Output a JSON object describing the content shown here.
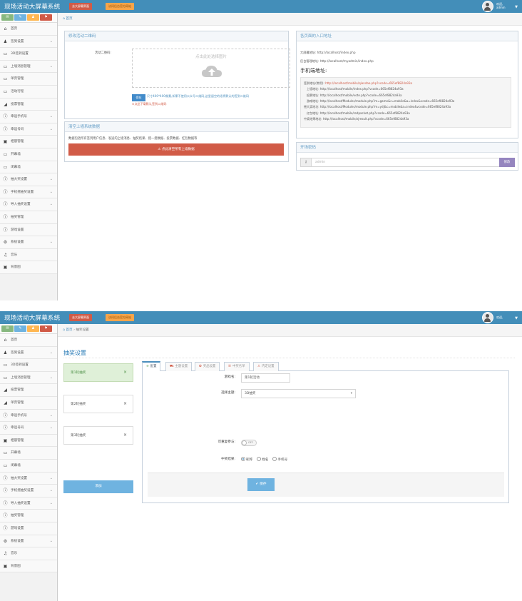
{
  "app": {
    "brand": "现场活动大屏幕系统",
    "btn_big_screen": "去大屏幕界面",
    "btn_official": "访问后台官方网站",
    "user_greeting": "欢迎,",
    "user_name": "admin"
  },
  "shortcut_icons": [
    "chat-icon",
    "pencil-icon",
    "group-icon",
    "share-icon"
  ],
  "colors": {
    "topbar": "#438eb9",
    "danger": "#d15b47",
    "warning": "#f7a54a",
    "primary": "#428bca",
    "info": "#6fb3e0",
    "purple": "#9585bf"
  },
  "nav1": [
    {
      "label": "首页",
      "icon": "home-icon",
      "arrow": false
    },
    {
      "label": "签到设置",
      "icon": "users-icon",
      "arrow": true
    },
    {
      "label": "3D签到设置",
      "icon": "desktop-icon",
      "arrow": false
    },
    {
      "label": "上墙消息管理",
      "icon": "desktop-icon",
      "arrow": true
    },
    {
      "label": "单页管理",
      "icon": "desktop-icon",
      "arrow": false
    },
    {
      "label": "活动行程",
      "icon": "desktop-icon",
      "arrow": false
    },
    {
      "label": "投票管理",
      "icon": "bar-chart-icon",
      "arrow": false
    },
    {
      "label": "幸运手机号",
      "icon": "info-icon",
      "arrow": true
    },
    {
      "label": "幸运号码",
      "icon": "info-icon",
      "arrow": true
    },
    {
      "label": "相册管理",
      "icon": "picture-icon",
      "arrow": false
    },
    {
      "label": "开幕墙",
      "icon": "desktop-icon",
      "arrow": false
    },
    {
      "label": "闭幕墙",
      "icon": "desktop-icon",
      "arrow": false
    },
    {
      "label": "抽大奖设置",
      "icon": "info-icon",
      "arrow": true
    },
    {
      "label": "手机摇抽奖设置",
      "icon": "info-icon",
      "arrow": true
    },
    {
      "label": "导入抽奖设置",
      "icon": "info-icon",
      "arrow": true
    },
    {
      "label": "抽奖管理",
      "icon": "info-icon",
      "arrow": false
    },
    {
      "label": "游戏设置",
      "icon": "info-icon",
      "arrow": false
    },
    {
      "label": "系统设置",
      "icon": "cog-icon",
      "arrow": true
    },
    {
      "label": "音乐",
      "icon": "music-icon",
      "arrow": false
    },
    {
      "label": "背景图",
      "icon": "picture-icon",
      "arrow": false
    }
  ],
  "nav2": [
    {
      "label": "首页",
      "icon": "home-icon",
      "arrow": false
    },
    {
      "label": "签到设置",
      "icon": "users-icon",
      "arrow": true
    },
    {
      "label": "3D签到设置",
      "icon": "desktop-icon",
      "arrow": false
    },
    {
      "label": "上墙消息管理",
      "icon": "desktop-icon",
      "arrow": true
    },
    {
      "label": "投票管理",
      "icon": "bar-chart-icon",
      "arrow": false
    },
    {
      "label": "单页管理",
      "icon": "bar-chart-icon",
      "arrow": false
    },
    {
      "label": "幸运手机号",
      "icon": "info-icon",
      "arrow": true
    },
    {
      "label": "幸运号码",
      "icon": "info-icon",
      "arrow": true
    },
    {
      "label": "相册管理",
      "icon": "picture-icon",
      "arrow": false
    },
    {
      "label": "开幕墙",
      "icon": "desktop-icon",
      "arrow": false
    },
    {
      "label": "闭幕墙",
      "icon": "desktop-icon",
      "arrow": false
    },
    {
      "label": "抽大奖设置",
      "icon": "info-icon",
      "arrow": true
    },
    {
      "label": "手机摇抽奖设置",
      "icon": "info-icon",
      "arrow": true
    },
    {
      "label": "导入抽奖设置",
      "icon": "info-icon",
      "arrow": true
    },
    {
      "label": "抽奖管理",
      "icon": "info-icon",
      "arrow": false
    },
    {
      "label": "游戏设置",
      "icon": "info-icon",
      "arrow": false
    },
    {
      "label": "系统设置",
      "icon": "cog-icon",
      "arrow": true
    },
    {
      "label": "音乐",
      "icon": "music-icon",
      "arrow": false
    },
    {
      "label": "背景图",
      "icon": "picture-icon",
      "arrow": false
    }
  ],
  "page1": {
    "breadcrumb": "首页",
    "qr_panel": {
      "title": "修改活动二维码",
      "label": "活动二维码:",
      "upload_text": "点击此处选择图片",
      "save_label": "保存",
      "hint": "尺寸400*400像素,如果不使用公众号二维码,这里留空的话将默认的签到二维码",
      "restore_link": "点此下载默认签到二维码"
    },
    "clear_panel": {
      "title": "清空上墙系统数据",
      "desc": "数据包括所有签到用户信息、发送的上墙消息、抽奖结果、摇一摇数据、投票数据、红包数据等",
      "button": "点此清空所有上墙数据"
    },
    "entry_panel": {
      "title": "各页面的入口地址",
      "big_screen": "大屏幕地址: http://localhost/index.php",
      "admin": "后台管理地址: http://localhost/myadmin/index.php",
      "mobile_title": "手机端地址:",
      "lines": [
        {
          "label": "签到地址(常用):",
          "url": "http://localhost/mobile/qiandao.php?vcode=665ef8824a93a",
          "red": true
        },
        {
          "label": "上墙地址:",
          "url": "http://localhost/mobile/index.php?vcode=665ef8824a93a",
          "red": false
        },
        {
          "label": "投票地址:",
          "url": "http://localhost/mobile/vote.php?vcode=665ef8824a93a",
          "red": false
        },
        {
          "label": "游戏地址:",
          "url": "http://localhost/Modules/module.php?m=game&c=mobile&a=index&vcode=665ef8824a93a",
          "red": false
        },
        {
          "label": "摇大奖地址:",
          "url": "http://localhost/Modules/module.php?m=ydj&c=mobile&a=index&vcode=665ef8824a93a",
          "red": false
        },
        {
          "label": "红包地址:",
          "url": "http://localhost/mobile/redpacket.php?vcode=665ef8824a93a",
          "red": false
        },
        {
          "label": "中奖结果地址:",
          "url": "http://localhost/mobile/zjresult.php?vcode=665ef8824a93a",
          "red": false
        }
      ]
    },
    "password_panel": {
      "title": "开场密码",
      "placeholder": "admin",
      "button": "修改"
    }
  },
  "page2": {
    "breadcrumb_home": "首页",
    "breadcrumb_current": "抽奖设置",
    "title": "抽奖设置",
    "rounds": [
      {
        "name": "第1轮抽奖",
        "active": true
      },
      {
        "name": "第2轮抽奖",
        "active": false
      },
      {
        "name": "第3轮抽奖",
        "active": false
      }
    ],
    "add_button": "添加",
    "tabs": [
      {
        "label": "配置",
        "icon": "plus-circle-icon",
        "active": true
      },
      {
        "label": "主题设置",
        "icon": "car-icon",
        "active": false
      },
      {
        "label": "奖品设置",
        "icon": "gift-icon",
        "active": false
      },
      {
        "label": "中奖名单",
        "icon": "list-icon",
        "active": false
      },
      {
        "label": "内定设置",
        "icon": "user-icon",
        "active": false
      }
    ],
    "form": {
      "name_label": "游戏名:",
      "name_value": "第1轮活动",
      "theme_label": "选择主题:",
      "theme_value": "3D抽奖",
      "repeat_label": "可重复参与:",
      "toggle_state": "OFF",
      "result_label": "中奖结果:",
      "radios": [
        {
          "label": "昵称",
          "checked": true
        },
        {
          "label": "姓名",
          "checked": false
        },
        {
          "label": "手机号",
          "checked": false
        }
      ],
      "save": "保存"
    }
  }
}
